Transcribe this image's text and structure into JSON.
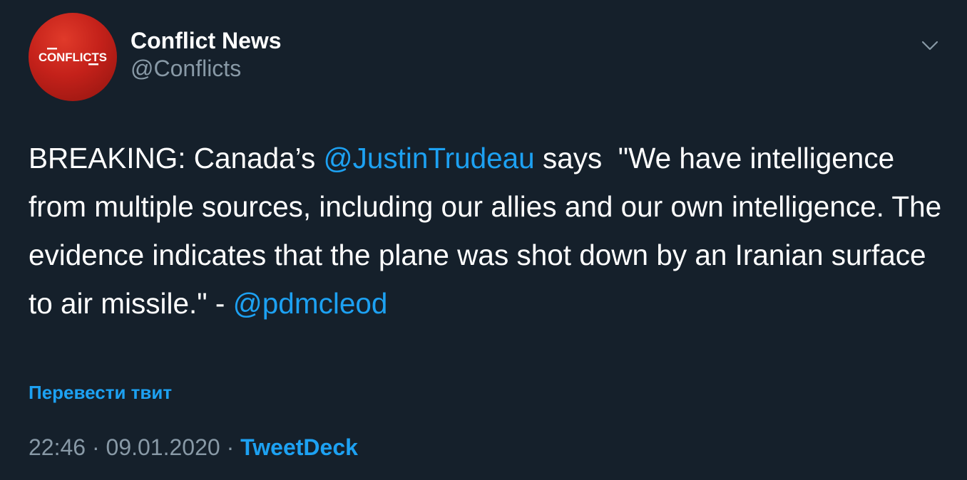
{
  "author": {
    "display_name": "Conflict News",
    "handle": "@Conflicts",
    "avatar_text": "CONFLICTS",
    "avatar_icon": "conflicts-logo-avatar"
  },
  "menu": {
    "icon": "chevron-down-icon"
  },
  "tweet": {
    "text_parts": [
      "BREAKING: Canada’s ",
      "@JustinTrudeau",
      " says  \"We have intelligence from multiple sources, including our allies and our own intelligence. The evidence indicates that the plane was shot down by an Iranian surface to air missile.\" - ",
      "@pdmcleod"
    ]
  },
  "translate_label": "Перевести твит",
  "meta": {
    "time": "22:46",
    "separator": "·",
    "date": "09.01.2020",
    "source": "TweetDeck"
  },
  "colors": {
    "background": "#15202b",
    "text": "#ffffff",
    "secondary": "#8899a6",
    "link": "#1da1f2",
    "avatar_red": "#c4211a"
  }
}
